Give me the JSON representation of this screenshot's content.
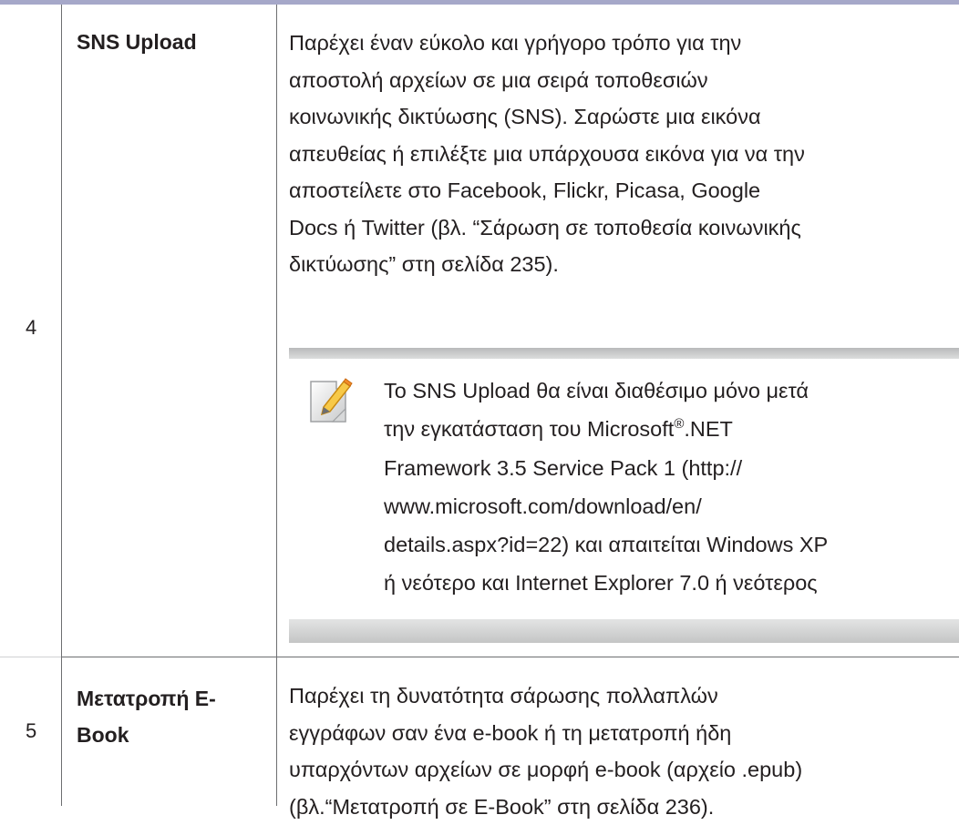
{
  "rows": [
    {
      "number": "4",
      "term": "SNS Upload",
      "description_lines": [
        "Παρέχει έναν εύκολο και γρήγορο τρόπο για την",
        "αποστολή αρχείων σε μια σειρά τοποθεσιών",
        "κοινωνικής δικτύωσης (SNS). Σαρώστε μια εικόνα",
        "απευθείας ή επιλέξτε μια υπάρχουσα εικόνα για να την",
        "αποστείλετε στο Facebook, Flickr, Picasa, Google",
        "Docs ή Twitter (βλ. “Σάρωση σε τοποθεσία κοινωνικής",
        "δικτύωσης” στη σελίδα 235)."
      ],
      "note": {
        "icon": "note-pencil-icon",
        "line1": "Το SNS Upload θα είναι διαθέσιμο μόνο μετά",
        "line2_before": "την εγκατάσταση του Microsoft",
        "line2_sup": "®",
        "line2_after": ".NET",
        "lines_rest": [
          "Framework 3.5 Service Pack 1 (http://",
          "www.microsoft.com/download/en/",
          "details.aspx?id=22) και απαιτείται Windows XP",
          "ή νεότερο και Internet Explorer 7.0 ή νεότερος"
        ]
      }
    },
    {
      "number": "5",
      "term_lines": [
        "Μετατροπή E-",
        "Book"
      ],
      "description_lines": [
        "Παρέχει τη δυνατότητα σάρωσης πολλαπλών",
        "εγγράφων σαν ένα e-book ή τη μετατροπή ήδη",
        "υπαρχόντων αρχείων σε μορφή e-book (αρχείο .epub)",
        "(βλ.“Μετατροπή σε E-Book” στη σελίδα 236)."
      ]
    }
  ],
  "colors": {
    "header_bar": "#a6a8c9",
    "rule": "#6d6e71",
    "note_band": "#c4c5c5",
    "text": "#231f20"
  }
}
